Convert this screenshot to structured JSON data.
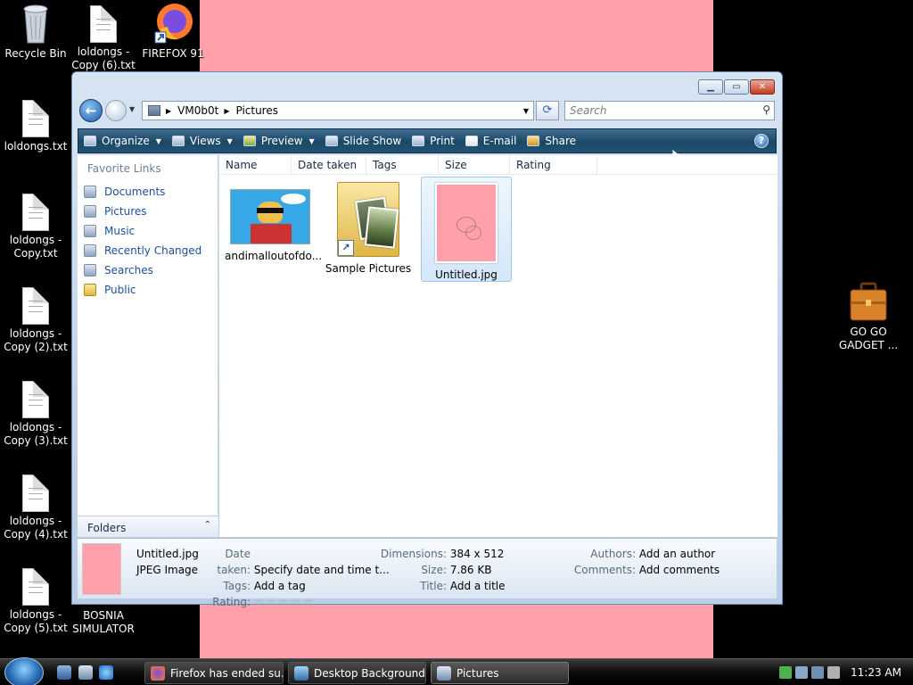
{
  "desktop": {
    "icons": [
      {
        "label": "Recycle Bin",
        "icon": "recycle-bin-icon"
      },
      {
        "label": "loldongs -\nCopy (6).txt",
        "icon": "text-file-icon"
      },
      {
        "label": "FIREFOX 91",
        "icon": "firefox-icon"
      },
      {
        "label": "loldongs.txt",
        "icon": "text-file-icon"
      },
      {
        "label": "loldongs -\nCopy.txt",
        "icon": "text-file-icon"
      },
      {
        "label": "loldongs -\nCopy (2).txt",
        "icon": "text-file-icon"
      },
      {
        "label": "loldongs -\nCopy (3).txt",
        "icon": "text-file-icon"
      },
      {
        "label": "loldongs -\nCopy (4).txt",
        "icon": "text-file-icon"
      },
      {
        "label": "loldongs -\nCopy (5).txt",
        "icon": "text-file-icon"
      },
      {
        "label": "BOSNIA\nSIMULATOR",
        "icon": "app-icon"
      },
      {
        "label": "GO GO\nGADGET ...",
        "icon": "briefcase-icon"
      }
    ],
    "wallpaper_color": "#ffa0ab"
  },
  "window": {
    "breadcrumb": [
      "VM0b0t",
      "Pictures"
    ],
    "search_placeholder": "Search",
    "toolbar": {
      "organize": "Organize",
      "views": "Views",
      "preview": "Preview",
      "slideshow": "Slide Show",
      "print": "Print",
      "email": "E-mail",
      "share": "Share"
    },
    "favorites": {
      "title": "Favorite Links",
      "items": [
        "Documents",
        "Pictures",
        "Music",
        "Recently Changed",
        "Searches",
        "Public"
      ]
    },
    "folders_label": "Folders",
    "columns": [
      "Name",
      "Date taken",
      "Tags",
      "Size",
      "Rating"
    ],
    "files": [
      {
        "name": "andimalloutofdo...",
        "type": "image"
      },
      {
        "name": "Sample Pictures",
        "type": "folder-shortcut"
      },
      {
        "name": "Untitled.jpg",
        "type": "image",
        "selected": true
      }
    ],
    "details": {
      "filename": "Untitled.jpg",
      "filetype": "JPEG Image",
      "date_taken_label": "Date taken:",
      "date_taken_value": "Specify date and time t...",
      "tags_label": "Tags:",
      "tags_value": "Add a tag",
      "rating_label": "Rating:",
      "rating_stars": "☆☆☆☆☆",
      "dimensions_label": "Dimensions:",
      "dimensions_value": "384 x 512",
      "size_label": "Size:",
      "size_value": "7.86 KB",
      "title_label": "Title:",
      "title_value": "Add a title",
      "authors_label": "Authors:",
      "authors_value": "Add an author",
      "comments_label": "Comments:",
      "comments_value": "Add comments"
    }
  },
  "taskbar": {
    "buttons": [
      "Firefox has ended su...",
      "Desktop Background",
      "Pictures"
    ],
    "active": "Pictures",
    "clock": "11:23 AM"
  }
}
